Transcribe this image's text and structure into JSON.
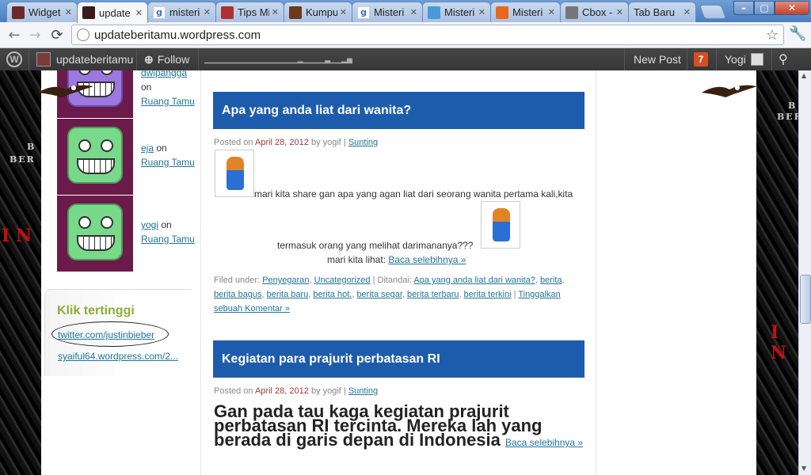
{
  "tabs": [
    {
      "label": "Widget",
      "fav": "#6a2a2a",
      "active": false
    },
    {
      "label": "update",
      "fav": "#3a1a1a",
      "active": true
    },
    {
      "label": "misteri",
      "fav": "google",
      "active": false
    },
    {
      "label": "Tips Mi",
      "fav": "#b03030",
      "active": false
    },
    {
      "label": "Kumpul",
      "fav": "#6a3a1a",
      "active": false
    },
    {
      "label": "Misteri",
      "fav": "google",
      "active": false
    },
    {
      "label": "Misteri",
      "fav": "#4a9ad6",
      "active": false
    },
    {
      "label": "Misteri",
      "fav": "#e8671e",
      "active": false
    },
    {
      "label": "Cbox - l",
      "fav": "#777",
      "active": false
    },
    {
      "label": "Tab Baru",
      "fav": "none",
      "active": false
    }
  ],
  "omnibox": {
    "url": "updateberitamu.wordpress.com"
  },
  "adminbar": {
    "blog_name": "updateberitamu",
    "follow": "Follow",
    "new_post": "New Post",
    "notif_count": "7",
    "user": "Yogi"
  },
  "sidebar": {
    "comments": [
      {
        "author": "dwipangga",
        "on": "on",
        "target": "Ruang Tamu"
      },
      {
        "author": "eja",
        "on": "on",
        "target": "Ruang Tamu"
      },
      {
        "author": "yogi",
        "on": "on",
        "target": "Ruang Tamu"
      }
    ],
    "widget_title": "Klik tertinggi",
    "top_links": [
      "twitter.com/justinbieber",
      "syaiful64.wordpress.com/2..."
    ]
  },
  "posts": [
    {
      "title": "Apa yang anda liat dari wanita?",
      "posted_on": "Posted on",
      "date": "April 28, 2012",
      "by": "by yogif |",
      "edit": "Sunting",
      "body1": "mari kita share gan apa yang agan liat dari seorang wanita pertama kali,kita",
      "body2": "termasuk orang yang melihat darimananya???",
      "body3": "mari kita lihat:",
      "read_more": "Baca selebihnya »",
      "filed_label": "Filed under:",
      "categories": [
        "Penyegaran",
        "Uncategorized"
      ],
      "tag_label": "| Ditandai:",
      "tags": [
        "Apa yang anda liat dari wanita?",
        "berita",
        "berita bagus",
        "berita baru",
        "berita hot.",
        "berita segar",
        "berita terbaru",
        "berita terkini"
      ],
      "comment_link": "Tinggalkan sebuah Komentar »"
    },
    {
      "title": "Kegiatan para prajurit perbatasan RI",
      "posted_on": "Posted on",
      "date": "April 28, 2012",
      "by": "by yogif |",
      "edit": "Sunting",
      "big_body": "Gan pada tau kaga kegiatan prajurit perbatasan RI tercinta. Mereka lah yang berada di garis depan di Indonesia",
      "read_more": "Baca selebihnya »"
    }
  ]
}
